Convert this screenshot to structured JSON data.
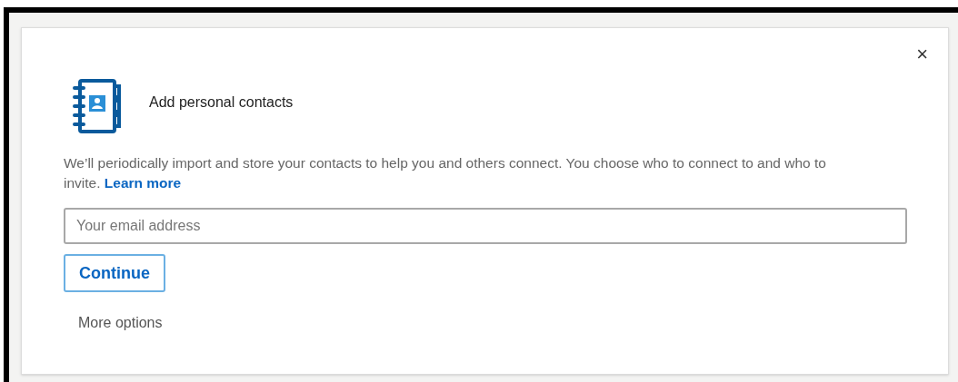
{
  "dialog": {
    "close_label": "×",
    "title": "Add personal contacts",
    "description": "We’ll periodically import and store your contacts to help you and others connect. You choose who to connect to and who to invite.",
    "learn_more": "Learn more",
    "email": {
      "placeholder": "Your email address"
    },
    "continue_button": "Continue",
    "more_options": "More options"
  }
}
